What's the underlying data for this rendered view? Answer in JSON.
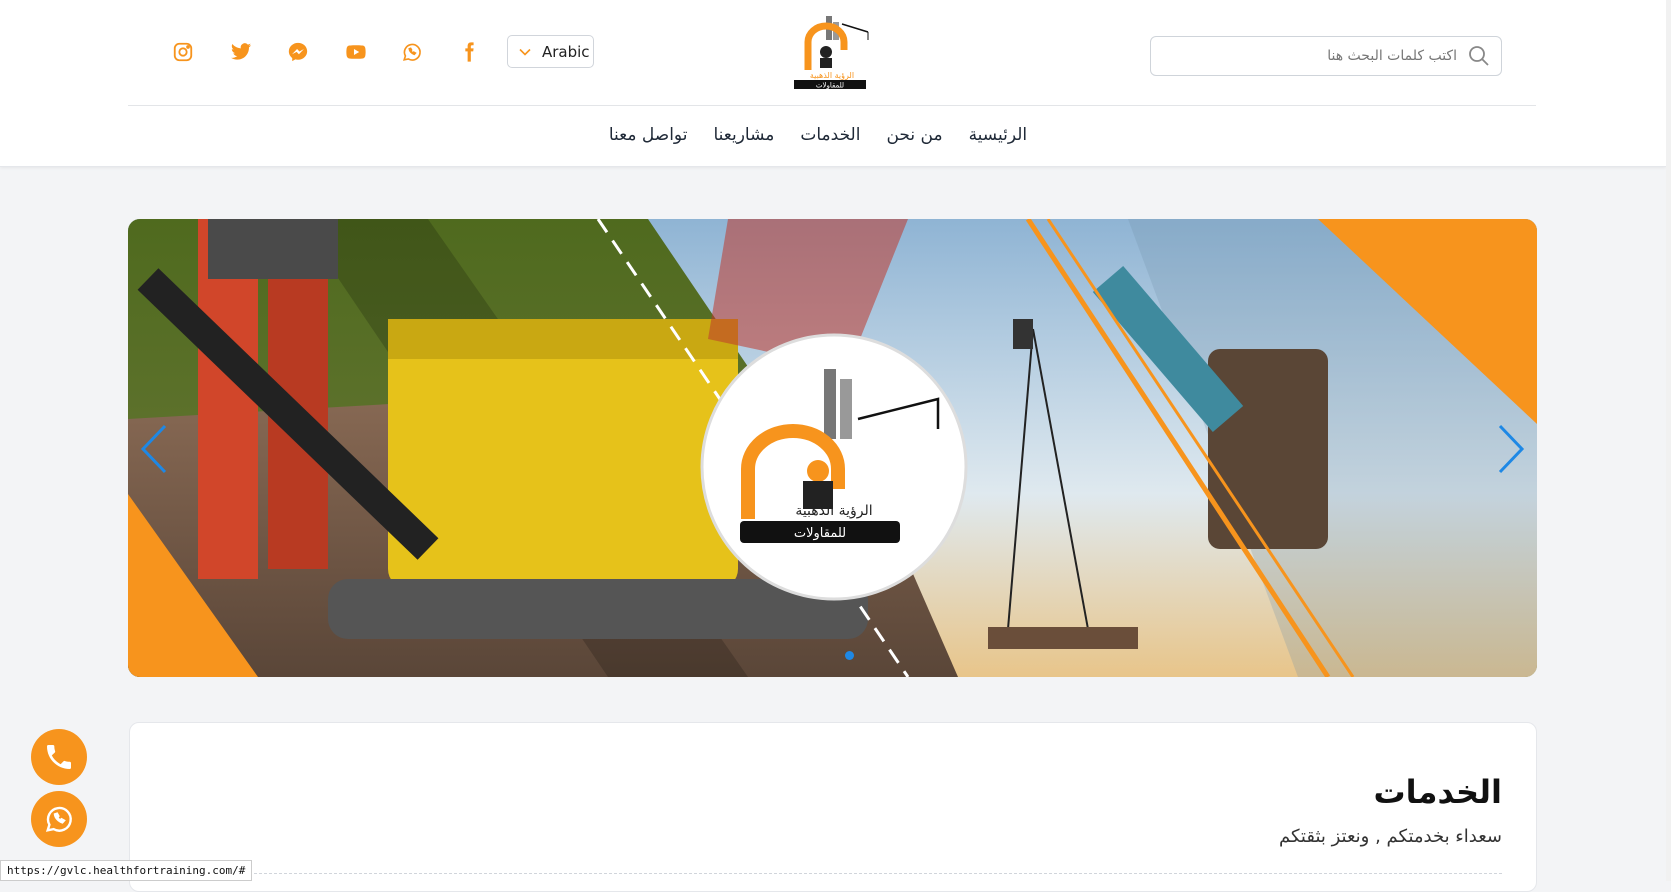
{
  "header": {
    "search_placeholder": "اكتب كلمات البحث هنا",
    "language": "Arabic",
    "social_icons": [
      "instagram-icon",
      "twitter-icon",
      "messenger-icon",
      "youtube-icon",
      "whatsapp-icon",
      "facebook-icon"
    ],
    "logo_text_1": "الرؤية الذهبية",
    "logo_text_2": "للمقاولات"
  },
  "nav": {
    "items": [
      {
        "label": "الرئيسية"
      },
      {
        "label": "من نحن"
      },
      {
        "label": "الخدمات"
      },
      {
        "label": "مشاريعنا"
      },
      {
        "label": "تواصل معنا"
      }
    ]
  },
  "slider": {
    "logo_text_1": "الرؤية الذهبية",
    "logo_text_2": "للمقاولات"
  },
  "services": {
    "title": "الخدمات",
    "subtitle": "سعداء بخدمتكم , ونعتز بثقتكم"
  },
  "floating": [
    "phone-icon",
    "whatsapp-icon"
  ],
  "status_bar": {
    "url": "https://gvlc.healthfortraining.com/#"
  },
  "colors": {
    "brand": "#f7941d",
    "accent_blue": "#1e88e5"
  }
}
